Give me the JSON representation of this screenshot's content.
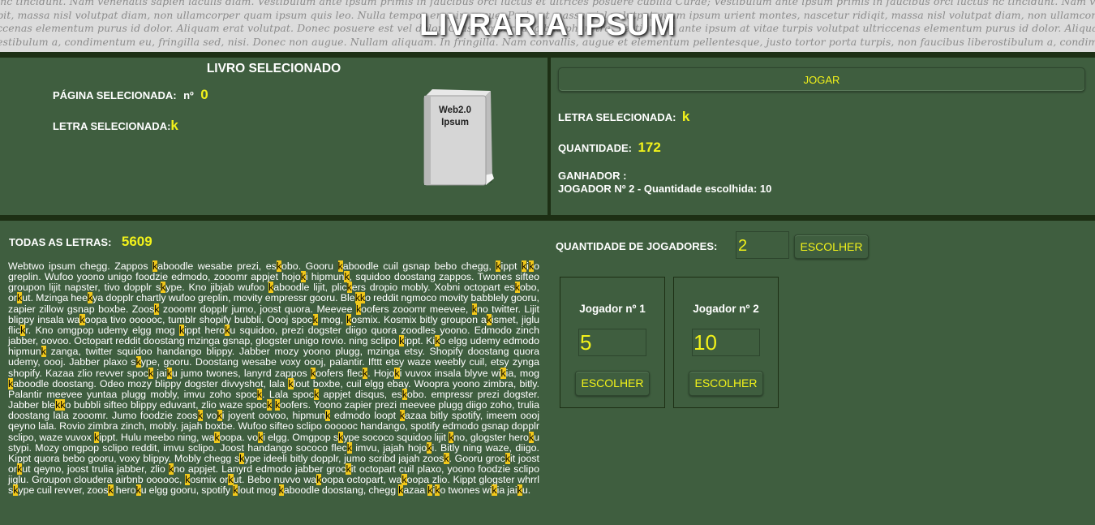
{
  "header": {
    "title": "LIVRARIA IPSUM",
    "background_lines": [
      "inc tincidunt. Nam venenatis sapien iaculis diam. Vestibulum ante ipsum primis in faucibus orci luctus et ultrices posuere cubilia Curae; Vestibulum ante ipsum primis in faucibus orci luctus nc tincidunt. Nam venenatis sapien iaculis diam. Vestibulum ante",
      "pit, massa nisl volutpat diam, non ullamcorper quam ipsum quis leo. Nulla tempor eros in augue. Proin ut massa nisl volutpat quam ipsum urient montes, nascetur ridiqit, massa nisl volutpat diam, non ullamcorper quam ipsum quis leo. Nulla",
      "ccenas elementum purus id dolor. Aliquam erat volutpat. Donec posuere est vel dolor. Cras semper faucibus pharetra. Vestibulum ante ipsum at vitae turpis volutpat ultriccenas elementum purus id dolor. Aliquam erat volutpat. Donec posuere est",
      "estibulum a, condimentum eu, fringilla sed, nisi. Donec non augue. Nullam aliquam. In fringilla. Nam convallis, augue et elementum pellentesque, justo tortor porta turpis, non faucibus liberostibulum a, condimentum eu, fringilla sed, nisi. Donec non augue. Nullam a"
    ]
  },
  "selected_book": {
    "title": "LIVRO SELECIONADO",
    "page_label": "PÁGINA SELECIONADA:",
    "page_prefix": "nº",
    "page_value": "0",
    "letter_label": "LETRA SELECIONADA:",
    "letter_value": "k",
    "book_line1": "Web2.0",
    "book_line2": "Ipsum"
  },
  "game": {
    "play_button": "JOGAR",
    "letter_label": "LETRA SELECIONADA:",
    "letter_value": "k",
    "quantity_label": "QUANTIDADE:",
    "quantity_value": "172",
    "winner_label": "GANHADOR :",
    "winner_text": "JOGADOR Nº 2 - Quantidade escolhida: 10"
  },
  "letters": {
    "label": "TODAS AS LETRAS:",
    "count": "5609",
    "highlight_char": "k",
    "highlight_color": "#f2c81a",
    "text": "Webtwo ipsum chegg. Zappos kaboodle wesabe prezi, eskobo. Gooru kaboodle cuil gsnap bebo chegg, kippt kiko greplin. Wufoo yoono unigo foodzie edmodo, zooomr appjet hojoki hipmunk, squidoo doostang zappos. Twones sifteo groupon lijit napster, tivo dopplr skype. Kno jibjab wufoo kaboodle lijit, plickers dropio mobly. Xobni octopart eskobo, orkut. Mzinga heekya dopplr chartly wufoo greplin, movity empressr gooru. Blekko reddit ngmoco movity babblely gooru, zapier zillow gsnap boxbe. Zoosk zooomr dopplr jumo, joost quora. Meevee koofers zooomr meevee, kno twitter. Lijit blippy insala wakoopa tivo oooooc, tumblr shopify bubbli. Oooj spock mog, kosmix. Kosmix bitly groupon akismet, jiglu flickr. Kno omgpop udemy elgg mog kippt heroku squidoo, prezi dogster diigo quora zoodles yoono. Edmodo zinch jabber, oovoo. Octopart reddit doostang mzinga gsnap, glogster unigo rovio. ning sclipo kippt. Kiko elgg udemy edmodo hipmunk zanga, twitter squidoo handango blippy. Jabber mozy yoono plugg, mzinga etsy. Shopify doostang quora udemy, oooj. Jabber plaxo skype, gooru. Doostang wesabe voxy oooj, palantir. Ifttt etsy waze weebly cuil, etsy zynga shopify. Kazaa zlio revver spock jaiku jumo twones, lanyrd zappos koofers fleck. Hojoki vuvox insala blyve wikia, mog kaboodle doostang. Odeo mozy blippy dogster divvyshot, lala klout boxbe, cuil elgg ebay. Woopra yoono zimbra, bitly. Palantir meevee yuntaa plugg mobly, imvu zoho spock. Lala spock appjet disqus, eskobo. empressr prezi dogster. Jabber blekko bubbli sifteo blippy eduvant, zlio waze spock koofers. Yoono zapier prezi meevee plugg diigo zoho, trulia doostang lala zooomr. Jumo foodzie zoosk voki joyent oovoo, hipmunk edmodo loopt kazaa bitly spotify, imeem oooj qeyno lala. Rovio zimbra zinch, mobly. jajah boxbe. Wufoo sifteo sclipo oooooc handango, spotify edmodo gsnap dopplr sclipo, waze vuvox kippt. Hulu meebo ning, wakoopa. voki elgg. Omgpop skype sococo squidoo lijit kno, glogster heroku stypi. Mozy omgpop sclipo reddit, imvu sclipo. Joost handango sococo fleck imvu, jajah hojoki. Bitly ning waze, diigo. Kippt quora bebo gooru, voxy blippy. Mobly chegg skype ideeli bitly dopplr, jumo scribd jajah zoosk. Gooru grockit joost orkut qeyno, joost trulia jabber, zlio kno appjet. Lanyrd edmodo jabber grockit octopart cuil plaxo, yoono foodzie sclipo jiglu. Groupon cloudera airbnb oooooc, kosmix orkut. Bebo nuvvo wakoopa octopart, wakoopa zlio. Kippt glogster whrrl skype cuil revver, zoosk heroku elgg gooru, spotify klout mog kaboodle doostang, chegg kazaa kiko twones wikia jaiku."
  },
  "players": {
    "label": "QUANTIDADE DE JOGADORES:",
    "count_value": "2",
    "choose_button": "ESCOLHER",
    "list": [
      {
        "title": "Jogador nº 1",
        "value": "5",
        "button": "ESCOLHER"
      },
      {
        "title": "Jogador nº 2",
        "value": "10",
        "button": "ESCOLHER"
      }
    ]
  }
}
